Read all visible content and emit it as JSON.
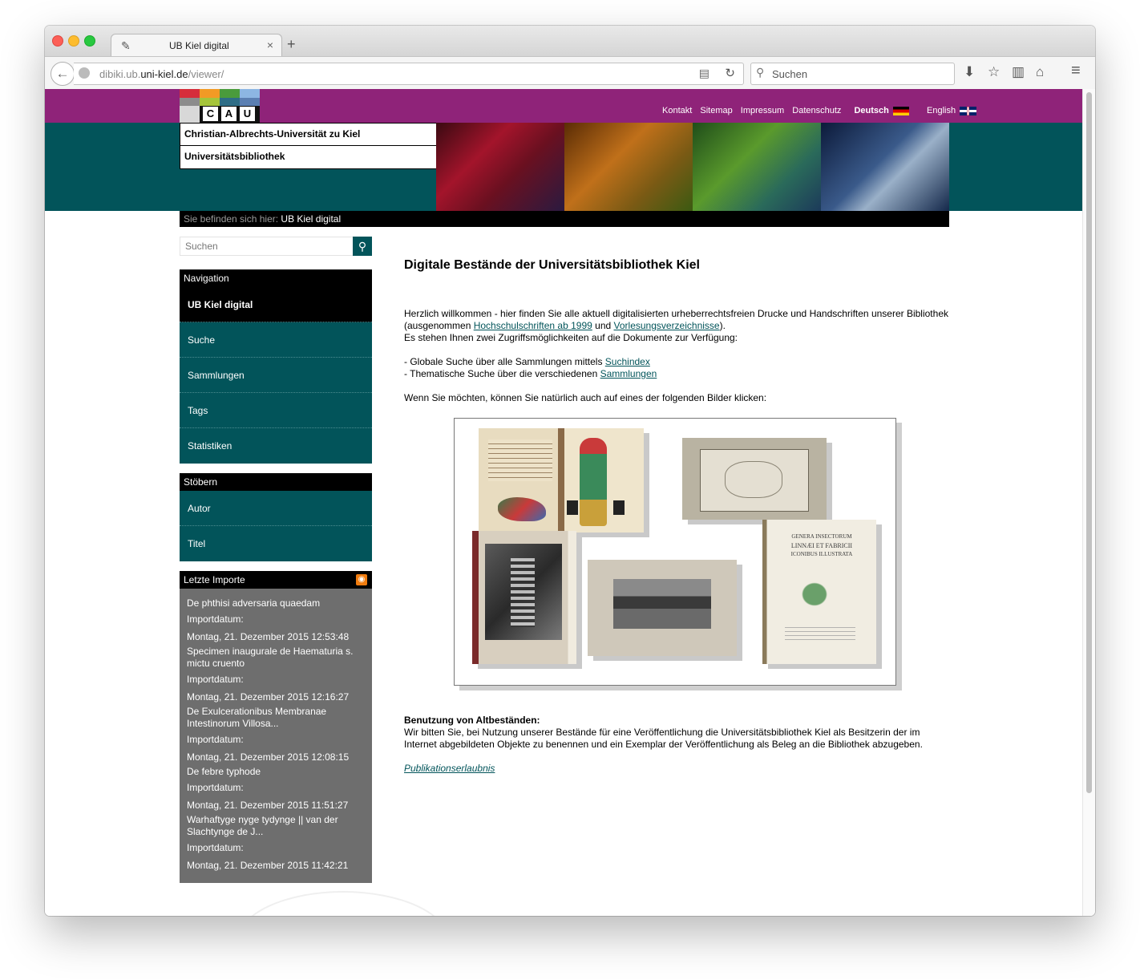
{
  "browser": {
    "tab_title": "UB Kiel digital",
    "tab_close": "×",
    "new_tab": "+",
    "url_prefix": "dibiki.ub.",
    "url_domain": "uni-kiel.de",
    "url_path": "/viewer/",
    "search_placeholder": "Suchen"
  },
  "icons": {
    "back": "←",
    "reader": "▤",
    "reload": "↻",
    "search": "⚲",
    "download": "⬇",
    "bookmark": "☆",
    "library": "▥",
    "home": "⌂",
    "menu": "≡"
  },
  "colors": {
    "purple": "#8f2379",
    "teal": "#02545a"
  },
  "header": {
    "logo_letters": [
      "C",
      "A",
      "U"
    ],
    "topnav": [
      "Kontakt",
      "Sitemap",
      "Impressum",
      "Datenschutz"
    ],
    "lang_de": "Deutsch",
    "lang_en": "English",
    "university": "Christian-Albrechts-Universität zu Kiel",
    "library": "Universitätsbibliothek",
    "breadcrumb_label": "Sie befinden sich hier:",
    "breadcrumb_value": "UB Kiel digital"
  },
  "sidebar": {
    "search_placeholder": "Suchen",
    "nav_heading": "Navigation",
    "nav_items": [
      "UB Kiel digital",
      "Suche",
      "Sammlungen",
      "Tags",
      "Statistiken"
    ],
    "browse_heading": "Stöbern",
    "browse_items": [
      "Autor",
      "Titel"
    ],
    "imports_heading": "Letzte Importe",
    "import_label": "Importdatum:",
    "imports": [
      {
        "title": "De phthisi adversaria quaedam",
        "date": "Montag, 21. Dezember 2015 12:53:48"
      },
      {
        "title": "Specimen inaugurale de Haematuria s. mictu cruento",
        "date": "Montag, 21. Dezember 2015 12:16:27"
      },
      {
        "title": "De Exulcerationibus Membranae Intestinorum Villosa...",
        "date": "Montag, 21. Dezember 2015 12:08:15"
      },
      {
        "title": "De febre typhode",
        "date": "Montag, 21. Dezember 2015 11:51:27"
      },
      {
        "title": "Warhaftyge nyge tydynge || van der Slachtynge de J...",
        "date": "Montag, 21. Dezember 2015 11:42:21"
      }
    ]
  },
  "main": {
    "title": "Digitale Bestände der Universitätsbibliothek Kiel",
    "intro1": "Herzlich willkommen - hier finden Sie alle aktuell digitalisierten urheberrechtsfreien Drucke und Handschriften unserer Bibliothek",
    "intro2_pre": "(ausgenommen ",
    "intro2_link1": "Hochschulschriften ab 1999",
    "intro2_mid": " und ",
    "intro2_link2": "Vorlesungsverzeichnisse",
    "intro2_post": ").",
    "intro3": "Es stehen Ihnen zwei Zugriffsmöglichkeiten auf die Dokumente zur Verfügung:",
    "opt1_pre": "- Globale Suche über alle Sammlungen mittels ",
    "opt1_link": "Suchindex",
    "opt2_pre": "- Thematische Suche über die verschiedenen ",
    "opt2_link": "Sammlungen",
    "click_hint": "Wenn Sie möchten, können Sie natürlich auch auf eines der folgenden Bilder klicken:",
    "usage_heading": "Benutzung von Altbeständen:",
    "usage1": "Wir bitten Sie, bei Nutzung unserer Bestände für eine Veröffentlichung die Universitätsbibliothek Kiel als Besitzerin der im",
    "usage2": "Internet abgebildeten Objekte zu benennen und ein Exemplar der Veröffentlichung als Beleg an die Bibliothek abzugeben.",
    "permission_link": "Publikationserlaubnis",
    "book_title_lines": [
      "GENERA INSECTORUM",
      "LINNÆI ET FABRICII",
      "ICONIBUS ILLUSTRATA"
    ]
  }
}
